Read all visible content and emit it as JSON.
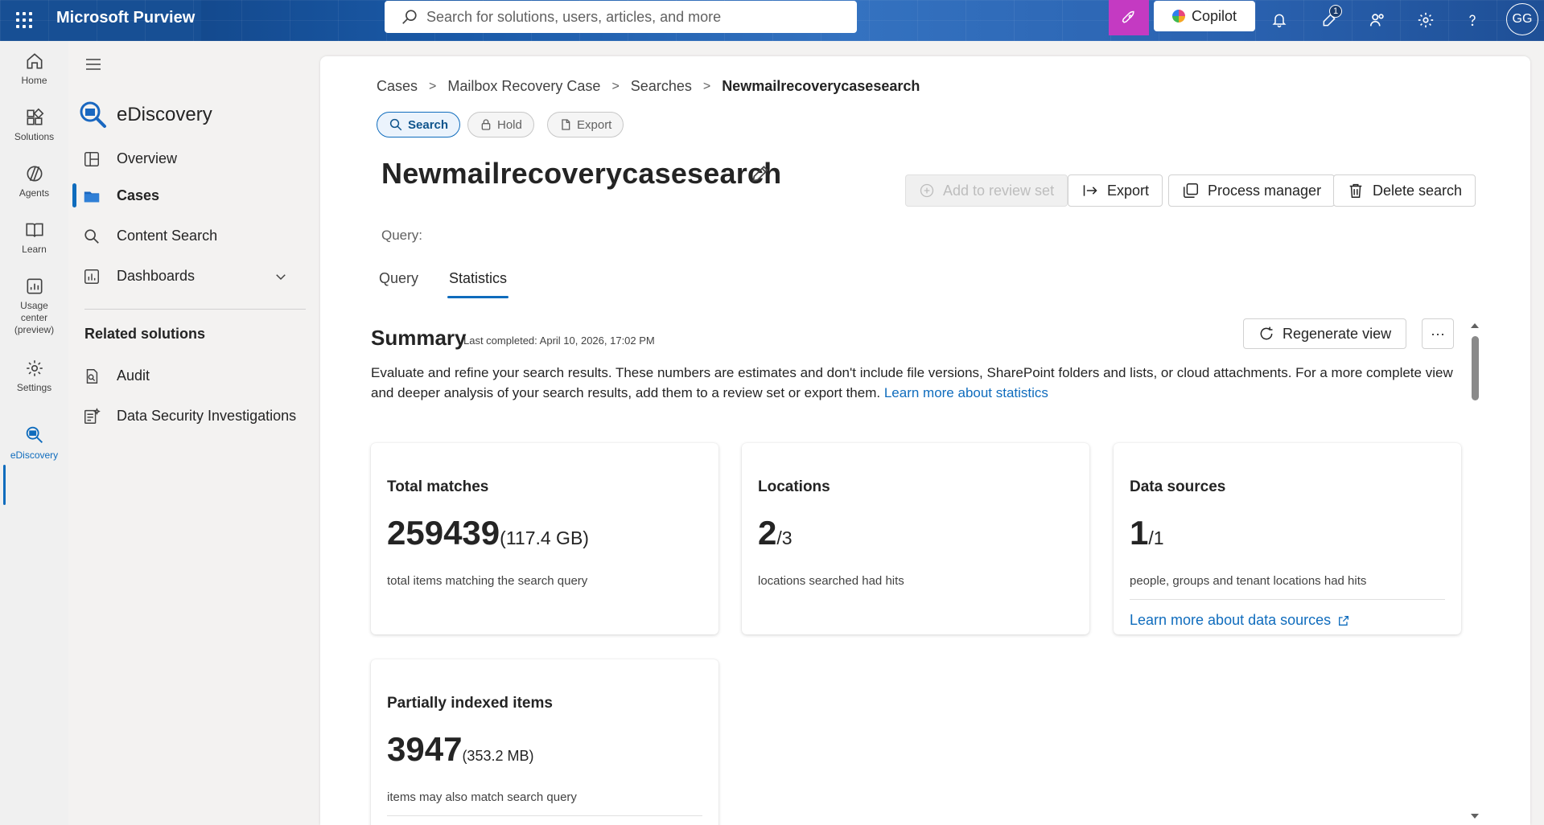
{
  "topbar": {
    "brand": "Microsoft Purview",
    "search_placeholder": "Search for solutions, users, articles, and more",
    "copilot_label": "Copilot",
    "notification_badge": "1",
    "avatar_initials": "GG"
  },
  "rail": {
    "items": [
      {
        "label": "Home",
        "icon": "home-icon"
      },
      {
        "label": "Solutions",
        "icon": "solutions-icon"
      },
      {
        "label": "Agents",
        "icon": "agents-icon"
      },
      {
        "label": "Learn",
        "icon": "book-icon"
      },
      {
        "label": "Usage center (preview)",
        "icon": "chart-icon"
      },
      {
        "label": "Settings",
        "icon": "gear-icon"
      },
      {
        "label": "eDiscovery",
        "icon": "ediscovery-icon"
      }
    ]
  },
  "sidebar": {
    "title": "eDiscovery",
    "items": [
      {
        "label": "Overview"
      },
      {
        "label": "Cases"
      },
      {
        "label": "Content Search"
      },
      {
        "label": "Dashboards"
      }
    ],
    "related_title": "Related solutions",
    "related_items": [
      {
        "label": "Audit"
      },
      {
        "label": "Data Security Investigations"
      }
    ]
  },
  "main": {
    "breadcrumb": [
      "Cases",
      "Mailbox Recovery Case",
      "Searches",
      "Newmailrecoverycasesearch"
    ],
    "pills": [
      {
        "label": "Search"
      },
      {
        "label": "Hold"
      },
      {
        "label": "Export"
      }
    ],
    "title": "Newmailrecoverycasesearch",
    "actions": {
      "add_review": "Add to review set",
      "export": "Export",
      "process_manager": "Process manager",
      "delete_search": "Delete search"
    },
    "query_label": "Query:",
    "tabs": [
      {
        "label": "Query"
      },
      {
        "label": "Statistics"
      }
    ],
    "summary": {
      "title": "Summary",
      "last_completed": "Last completed: April 10, 2026, 17:02 PM",
      "regenerate": "Regenerate view",
      "more": "···",
      "description": "Evaluate and refine your search results. These numbers are estimates and don't include file versions, SharePoint folders and lists, or cloud attachments. For a more complete view and deeper analysis of your search results, add them to a review set or export them. ",
      "learn_more": "Learn more about statistics"
    },
    "cards": {
      "total": {
        "title": "Total matches",
        "value": "259439",
        "sub": "(117.4 GB)",
        "desc": "total items matching the search query"
      },
      "locations": {
        "title": "Locations",
        "value": "2",
        "sub": "/3",
        "desc": "locations searched had hits"
      },
      "sources": {
        "title": "Data sources",
        "value": "1",
        "sub": "/1",
        "desc": "people, groups and tenant locations had hits",
        "link": "Learn more about data sources"
      },
      "partial": {
        "title": "Partially indexed items",
        "value": "3947",
        "sub": "(353.2 MB)",
        "desc": "items may also match search query"
      }
    }
  }
}
